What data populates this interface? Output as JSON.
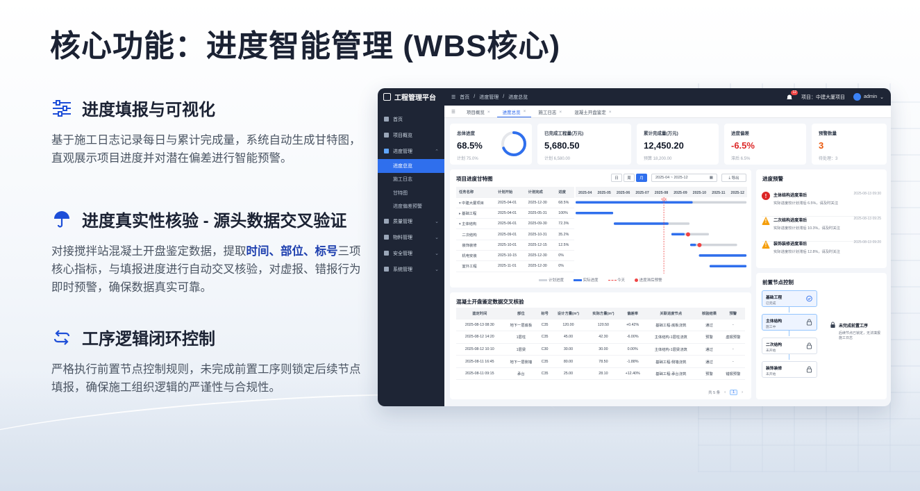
{
  "page": {
    "title": "核心功能：进度智能管理 (WBS核心)"
  },
  "features": [
    {
      "icon": "sliders-icon",
      "heading": "进度填报与可视化",
      "desc": "基于施工日志记录每日与累计完成量，系统自动生成甘特图，直观展示项目进度并对潜在偏差进行智能预警。"
    },
    {
      "icon": "umbrella-icon",
      "heading": "进度真实性核验 - 源头数据交叉验证",
      "desc_pre": "对接搅拌站混凝土开盘鉴定数据，提取",
      "desc_hl": "时间、部位、标号",
      "desc_post": "三项核心指标，与填报进度进行自动交叉核验，对虚报、错报行为即时预警，确保数据真实可靠。"
    },
    {
      "icon": "cycle-arrows-icon",
      "heading": "工序逻辑闭环控制",
      "desc": "严格执行前置节点控制规则，未完成前置工序则锁定后续节点填报，确保施工组织逻辑的严谨性与合规性。"
    }
  ],
  "app": {
    "brand": "工程管理平台",
    "breadcrumb": [
      "首页",
      "/",
      "进度管理",
      "/",
      "进度总览"
    ],
    "notification_count": "12",
    "project_label": "项目：中建大厦项目",
    "user": "admin",
    "sidebar": [
      {
        "label": "首页",
        "icon": "home-icon"
      },
      {
        "label": "项目概览",
        "icon": "grid-icon"
      },
      {
        "label": "进度管理",
        "icon": "chart-icon",
        "expanded": true
      }
    ],
    "sidebar_sub": [
      "进度总览",
      "施工日志",
      "甘特图",
      "进度偏差预警"
    ],
    "sidebar_rest": [
      {
        "label": "质量管理",
        "icon": "quality-icon"
      },
      {
        "label": "物料管理",
        "icon": "box-icon"
      },
      {
        "label": "安全管理",
        "icon": "shield-icon"
      },
      {
        "label": "系统管理",
        "icon": "gear-icon"
      }
    ],
    "tabs": [
      "项目概览",
      "进度总览",
      "施工日志",
      "混凝土开盘鉴定"
    ],
    "kpis": [
      {
        "label": "总体进度",
        "value": "68.5%",
        "sub": "计划  75.0%",
        "ring_value": 0.685
      },
      {
        "label": "已完成工程量(万元)",
        "value": "5,680.50",
        "sub": "计划  6,580.00"
      },
      {
        "label": "累计完成量(万元)",
        "value": "12,450.20",
        "sub": "预算  18,200.00"
      },
      {
        "label": "进度偏差",
        "value": "-6.5%",
        "sub": "滞后  6.5%"
      },
      {
        "label": "预警数量",
        "value": "3",
        "sub": "待处理：3"
      }
    ],
    "gantt": {
      "title": "项目进度甘特图",
      "view_buttons": [
        "日",
        "周",
        "月"
      ],
      "date_range": "2025-04 ~ 2025-12",
      "export": "导出",
      "columns": [
        "任务名称",
        "计划开始",
        "计划完成",
        "进度"
      ],
      "months": [
        "2025-04",
        "2025-05",
        "2025-06",
        "2025-07",
        "2025-08",
        "2025-09",
        "2025-10",
        "2025-11",
        "2025-12"
      ],
      "today_label": "今天",
      "rows": [
        {
          "name": "中建大厦项目",
          "start": "2025-04-01",
          "end": "2025-12-30",
          "progress": "68.5%"
        },
        {
          "name": "基础工程",
          "start": "2025-04-01",
          "end": "2025-05-31",
          "progress": "100%"
        },
        {
          "name": "主体结构",
          "start": "2025-06-01",
          "end": "2025-09-30",
          "progress": "72.3%"
        },
        {
          "name": "二次结构",
          "start": "2025-09-01",
          "end": "2025-10-31",
          "progress": "35.2%"
        },
        {
          "name": "装饰装修",
          "start": "2025-10-01",
          "end": "2025-12-15",
          "progress": "12.5%"
        },
        {
          "name": "机电安装",
          "start": "2025-10-15",
          "end": "2025-12-30",
          "progress": "0%"
        },
        {
          "name": "室外工程",
          "start": "2025-11-01",
          "end": "2025-12-30",
          "progress": "0%"
        }
      ],
      "legend": [
        "计划进度",
        "实际进度",
        "今天",
        "进度滞后预警"
      ]
    },
    "verify": {
      "title": "混凝土开盘鉴定数据交叉核验",
      "columns": [
        "鉴定时间",
        "部位",
        "标号",
        "设计方量(m³)",
        "实际方量(m³)",
        "偏差率",
        "关联进度节点",
        "核验结果",
        "预警"
      ],
      "rows": [
        [
          "2025-08-13 08:30",
          "地下一层底板",
          "C35",
          "120.00",
          "120.50",
          "+0.42%",
          "基础工程-底板浇筑",
          "通过",
          "-"
        ],
        [
          "2025-08-12 14:20",
          "1层柱",
          "C35",
          "45.00",
          "42.30",
          "-6.00%",
          "主体结构-1层柱浇筑",
          "预警",
          "虚报预警"
        ],
        [
          "2025-08-12 10:10",
          "1层梁",
          "C30",
          "30.00",
          "30.00",
          "0.00%",
          "主体结构-1层梁浇筑",
          "通过",
          "-"
        ],
        [
          "2025-08-11 16:45",
          "地下一层侧墙",
          "C35",
          "80.00",
          "78.50",
          "-1.88%",
          "基础工程-侧墙浇筑",
          "通过",
          "-"
        ],
        [
          "2025-08-11 09:15",
          "承台",
          "C35",
          "25.00",
          "28.10",
          "+12.40%",
          "基础工程-承台浇筑",
          "预警",
          "错报预警"
        ]
      ],
      "pagination_total": "共 5 条",
      "page": "1"
    },
    "alerts": {
      "title": "进度预警",
      "items": [
        {
          "title": "主体结构进度滞后",
          "desc": "实际进度较计划滞后 6.5%，请及时关注",
          "time": "2025-08-13 09:30",
          "level": "red"
        },
        {
          "title": "二次结构进度滞后",
          "desc": "实际进度较计划滞后 10.3%，请及时关注",
          "time": "2025-08-13 09:25",
          "level": "orange"
        },
        {
          "title": "装饰装修进度滞后",
          "desc": "实际进度较计划滞后 12.8%，请及时关注",
          "time": "2025-08-13 09:20",
          "level": "orange"
        }
      ]
    },
    "prereq": {
      "title": "前置节点控制",
      "nodes": [
        {
          "name": "基础工程",
          "status": "已完成",
          "state": "done"
        },
        {
          "name": "主体结构",
          "status": "施工中",
          "state": "cur"
        },
        {
          "name": "二次结构",
          "status": "未开始",
          "state": "locked"
        },
        {
          "name": "装饰装修",
          "status": "未开始",
          "state": "locked"
        }
      ],
      "note_title": "未完成前置工序",
      "note_desc": "后续节点已锁定，无法填报施工日志"
    },
    "colors": {
      "sidebar": "#1e2535",
      "accent": "#2f6fed",
      "danger": "#dc2626",
      "warning": "#f59e0b"
    }
  }
}
